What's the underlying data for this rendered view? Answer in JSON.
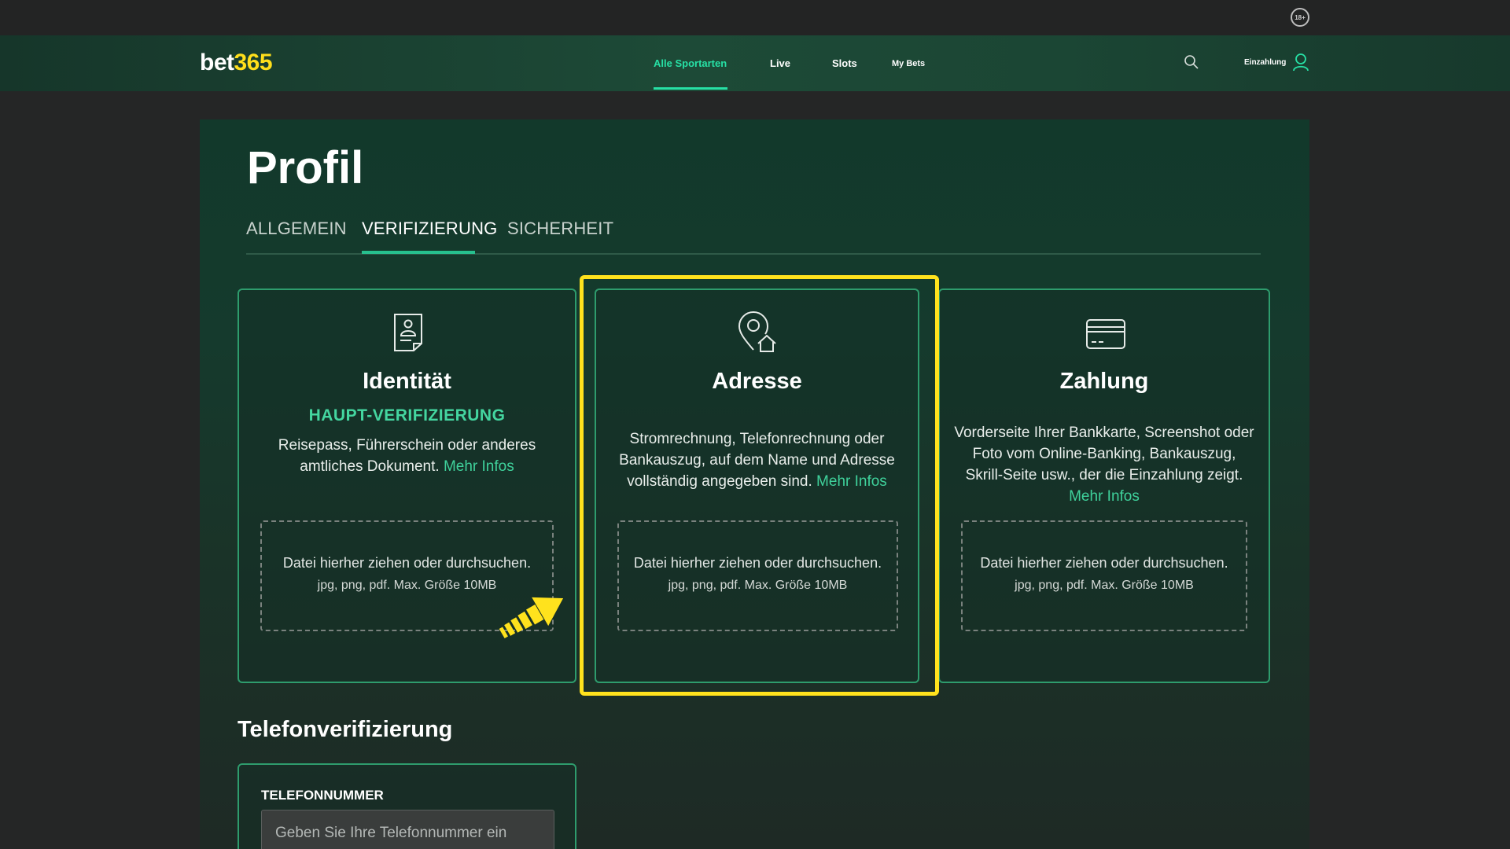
{
  "top": {
    "age_badge": "18+"
  },
  "header": {
    "logo_part1": "bet",
    "logo_part2": "365",
    "nav": [
      {
        "label": "Alle Sportarten",
        "active": true
      },
      {
        "label": "Live",
        "active": false
      },
      {
        "label": "Slots",
        "active": false
      },
      {
        "label": "My Bets",
        "active": false
      }
    ],
    "deposit_label": "Einzahlung"
  },
  "page": {
    "title": "Profil",
    "tabs": [
      {
        "label": "ALLGEMEIN",
        "active": false
      },
      {
        "label": "VERIFIZIERUNG",
        "active": true
      },
      {
        "label": "SICHERHEIT",
        "active": false
      }
    ]
  },
  "cards": [
    {
      "icon": "id-document-icon",
      "title": "Identität",
      "subtitle": "HAUPT-VERIFIZIERUNG",
      "description": "Reisepass, Führerschein oder anderes amtliches Dokument.",
      "link": "Mehr Infos",
      "drop_line1": "Datei hierher ziehen oder durchsuchen.",
      "drop_line2": "jpg, png, pdf. Max. Größe 10MB"
    },
    {
      "icon": "location-home-icon",
      "title": "Adresse",
      "description": "Stromrechnung, Telefonrechnung oder Bankauszug, auf dem Name und Adresse vollständig angegeben sind.",
      "link": "Mehr Infos",
      "drop_line1": "Datei hierher ziehen oder durchsuchen.",
      "drop_line2": "jpg, png, pdf. Max. Größe 10MB"
    },
    {
      "icon": "credit-card-icon",
      "title": "Zahlung",
      "description": "Vorderseite Ihrer Bankkarte, Screenshot oder Foto vom Online-Banking, Bankauszug, Skrill-Seite usw., der die Einzahlung zeigt.",
      "link": "Mehr Infos",
      "drop_line1": "Datei hierher ziehen oder durchsuchen.",
      "drop_line2": "jpg, png, pdf. Max. Größe 10MB"
    }
  ],
  "phone": {
    "section_title": "Telefonverifizierung",
    "label": "TELEFONNUMMER",
    "placeholder": "Geben Sie Ihre Telefonnummer ein"
  },
  "colors": {
    "accent": "#27e0a5",
    "brand_yellow": "#ffdf1b",
    "highlight": "#ffe21d",
    "card_border": "#2e9c6d"
  }
}
